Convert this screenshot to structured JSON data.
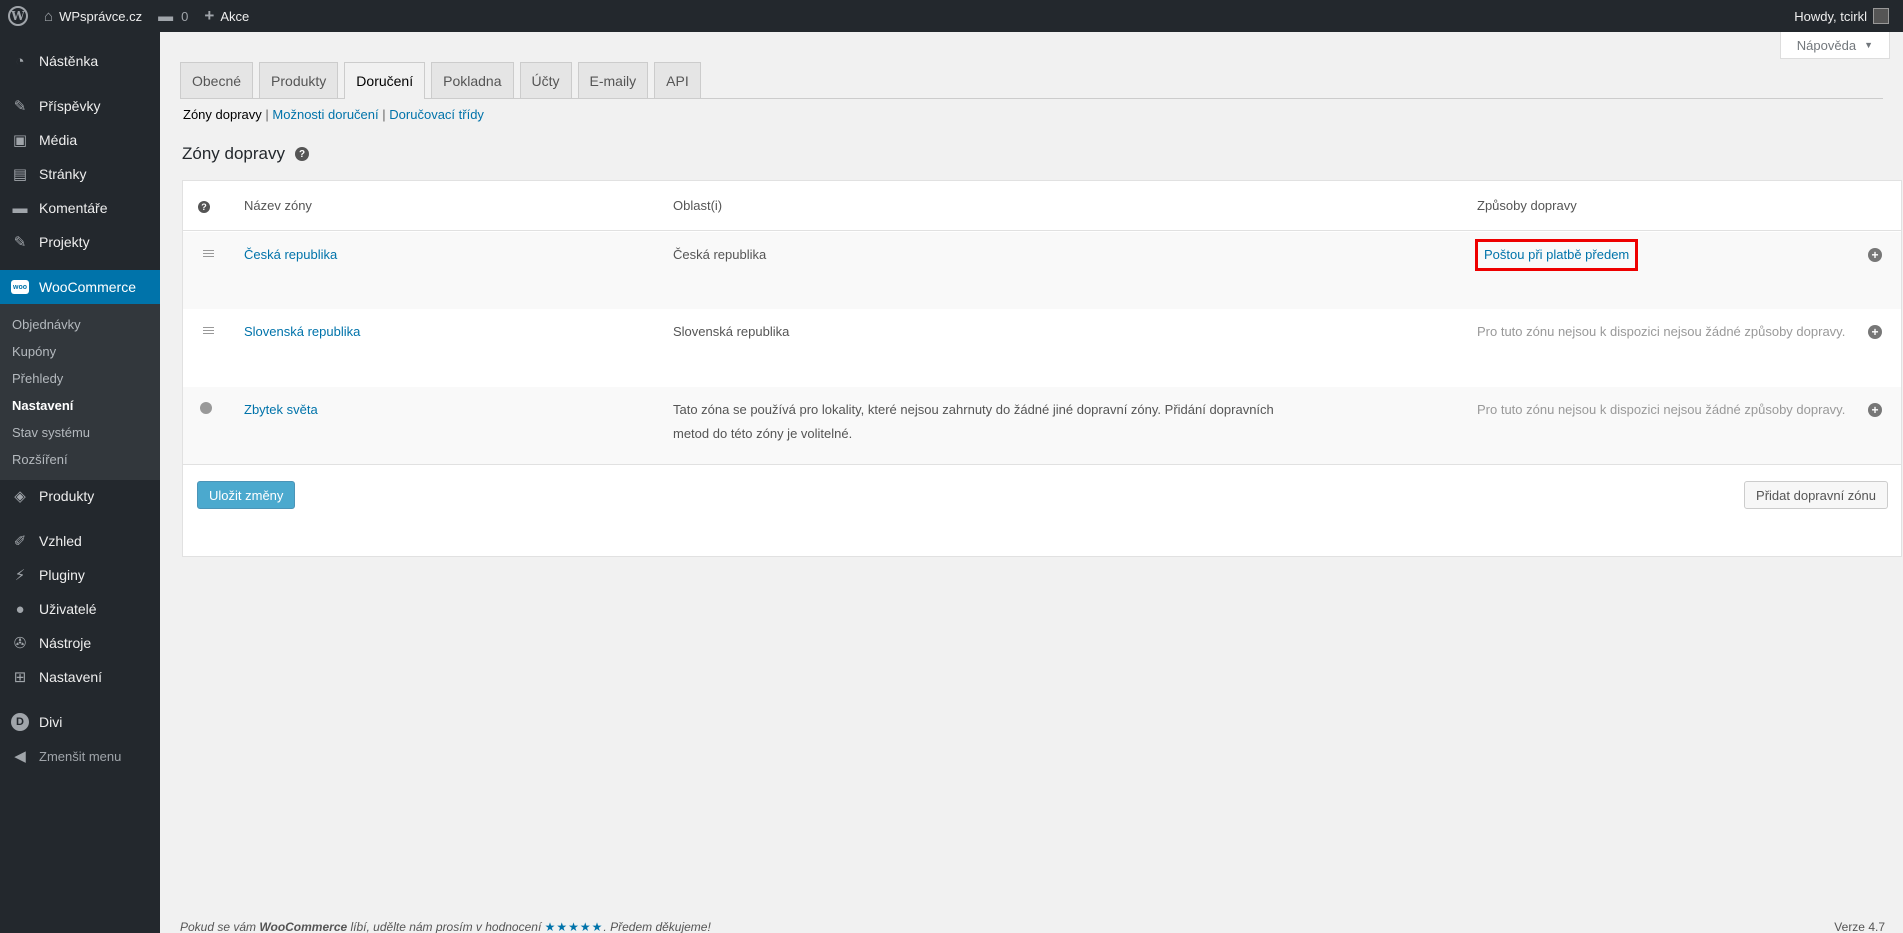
{
  "adminbar": {
    "site_name": "WPsprávce.cz",
    "comments_count": "0",
    "new_label": "Akce",
    "howdy": "Howdy, tcirkl"
  },
  "sidebar": {
    "items_top": [
      {
        "label": "Nástěnka",
        "icon": "dashboard-icon"
      },
      {
        "label": "Příspěvky",
        "icon": "pin-icon"
      },
      {
        "label": "Média",
        "icon": "media-icon"
      },
      {
        "label": "Stránky",
        "icon": "page-icon"
      },
      {
        "label": "Komentáře",
        "icon": "comment-icon"
      },
      {
        "label": "Projekty",
        "icon": "pin-icon"
      }
    ],
    "woocommerce": {
      "label": "WooCommerce",
      "icon_text": "woo",
      "submenu": [
        "Objednávky",
        "Kupóny",
        "Přehledy",
        "Nastavení",
        "Stav systému",
        "Rozšíření"
      ]
    },
    "items_bottom": [
      {
        "label": "Produkty"
      },
      {
        "label": "Vzhled"
      },
      {
        "label": "Pluginy"
      },
      {
        "label": "Uživatelé"
      },
      {
        "label": "Nástroje"
      },
      {
        "label": "Nastavení"
      },
      {
        "label": "Divi"
      },
      {
        "label": "Zmenšit menu"
      }
    ]
  },
  "help": {
    "label": "Nápověda"
  },
  "tabs": [
    "Obecné",
    "Produkty",
    "Doručení",
    "Pokladna",
    "Účty",
    "E-maily",
    "API"
  ],
  "subsub": {
    "current": "Zóny dopravy",
    "link1": "Možnosti doručení",
    "link2": "Doručovací třídy",
    "sep": "|"
  },
  "page_title": "Zóny dopravy",
  "table": {
    "headers": {
      "name": "Název zóny",
      "region": "Oblast(i)",
      "methods": "Způsoby dopravy"
    },
    "rows": [
      {
        "name": "Česká republika",
        "region": "Česká republika",
        "methods": "Poštou při platbě předem"
      },
      {
        "name": "Slovenská republika",
        "region": "Slovenská republika",
        "methods": "Pro tuto zónu nejsou k dispozici nejsou žádné způsoby dopravy."
      },
      {
        "name": "Zbytek světa",
        "region": "Tato zóna se používá pro lokality, které nejsou zahrnuty do žádné jiné dopravní zóny. Přidání dopravních metod do této zóny je volitelné.",
        "methods": "Pro tuto zónu nejsou k dispozici nejsou žádné způsoby dopravy."
      }
    ],
    "save_button": "Uložit změny",
    "add_zone_button": "Přidat dopravní zónu"
  },
  "footer": {
    "text_before": "Pokud se vám ",
    "brand": "WooCommerce",
    "text_mid": " líbí, udělte nám prosím v hodnocení ",
    "stars": "★★★★★",
    "text_after": ". Předem děkujeme!",
    "version": "Verze 4.7"
  },
  "colors": {
    "accent": "#0073aa",
    "highlight": "#e00000",
    "adminbar": "#23282d"
  }
}
